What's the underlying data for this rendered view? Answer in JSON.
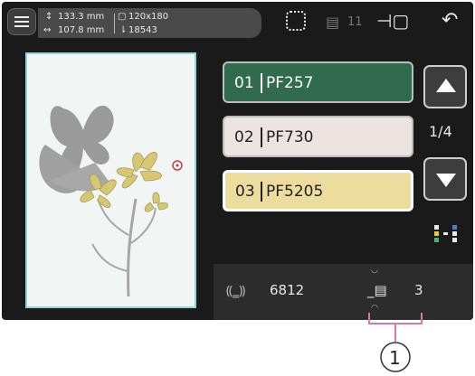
{
  "header": {
    "height_value": "133.3 mm",
    "width_value": "107.8 mm",
    "hoop_size": "120x180",
    "stitch_count": "18543",
    "thread_count": "11"
  },
  "colors": {
    "page_indicator": "1/4",
    "items": [
      {
        "index": "01",
        "code": "PF257",
        "color": "#2f6b4c",
        "text_color": "#ffffff"
      },
      {
        "index": "02",
        "code": "PF730",
        "color": "#ece4e1",
        "text_color": "#222222"
      },
      {
        "index": "03",
        "code": "PF5205",
        "color": "#ecdc9e",
        "text_color": "#222222",
        "selected": true
      }
    ]
  },
  "status": {
    "bobbin_value": "6812",
    "thread_value": "3"
  },
  "callout": {
    "label": "1"
  },
  "icons": [
    "menu-icon",
    "dotted-frame-icon",
    "spool-icon",
    "exit-icon",
    "undo-icon",
    "up-arrow-icon",
    "down-arrow-icon",
    "split-color-icon",
    "bobbin-icon",
    "thread-spool-icon"
  ]
}
